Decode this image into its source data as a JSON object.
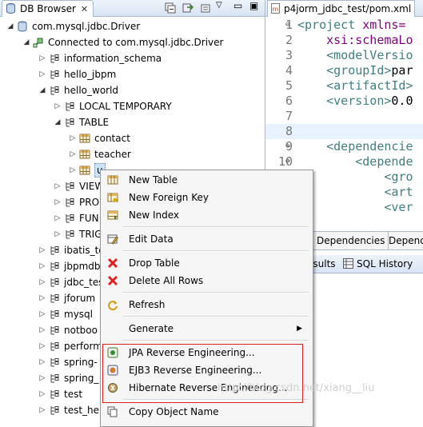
{
  "db_browser": {
    "title": "DB Browser",
    "tree": [
      {
        "label": "com.mysql.jdbc.Driver",
        "level": 0,
        "toggle": "expanded",
        "icon": "db-driver-icon"
      },
      {
        "label": "Connected to com.mysql.jdbc.Driver",
        "level": 1,
        "toggle": "expanded",
        "icon": "connection-icon"
      },
      {
        "label": "information_schema",
        "level": 2,
        "toggle": "collapsed",
        "icon": "schema-icon"
      },
      {
        "label": "hello_jbpm",
        "level": 2,
        "toggle": "collapsed",
        "icon": "schema-icon"
      },
      {
        "label": "hello_world",
        "level": 2,
        "toggle": "expanded",
        "icon": "schema-icon"
      },
      {
        "label": "LOCAL TEMPORARY",
        "level": 3,
        "toggle": "collapsed",
        "icon": "schema-icon"
      },
      {
        "label": "TABLE",
        "level": 3,
        "toggle": "expanded",
        "icon": "schema-icon"
      },
      {
        "label": "contact",
        "level": 4,
        "toggle": "collapsed",
        "icon": "table-icon"
      },
      {
        "label": "teacher",
        "level": 4,
        "toggle": "collapsed",
        "icon": "table-icon"
      },
      {
        "label": "u",
        "level": 4,
        "toggle": "collapsed",
        "icon": "table-icon",
        "selected": true
      },
      {
        "label": "VIEW",
        "level": 3,
        "toggle": "collapsed",
        "icon": "schema-icon"
      },
      {
        "label": "PRO",
        "level": 3,
        "toggle": "collapsed",
        "icon": "schema-icon"
      },
      {
        "label": "FUN",
        "level": 3,
        "toggle": "collapsed",
        "icon": "schema-icon"
      },
      {
        "label": "TRIG",
        "level": 3,
        "toggle": "collapsed",
        "icon": "schema-icon"
      },
      {
        "label": "ibatis_te",
        "level": 2,
        "toggle": "collapsed",
        "icon": "schema-icon"
      },
      {
        "label": "jbpmdb",
        "level": 2,
        "toggle": "collapsed",
        "icon": "schema-icon"
      },
      {
        "label": "jdbc_tes",
        "level": 2,
        "toggle": "collapsed",
        "icon": "schema-icon"
      },
      {
        "label": "jforum",
        "level": 2,
        "toggle": "collapsed",
        "icon": "schema-icon"
      },
      {
        "label": "mysql",
        "level": 2,
        "toggle": "collapsed",
        "icon": "schema-icon"
      },
      {
        "label": "notboo",
        "level": 2,
        "toggle": "collapsed",
        "icon": "schema-icon"
      },
      {
        "label": "perform",
        "level": 2,
        "toggle": "collapsed",
        "icon": "schema-icon"
      },
      {
        "label": "spring-",
        "level": 2,
        "toggle": "collapsed",
        "icon": "schema-icon"
      },
      {
        "label": "spring_",
        "level": 2,
        "toggle": "collapsed",
        "icon": "schema-icon"
      },
      {
        "label": "test",
        "level": 2,
        "toggle": "collapsed",
        "icon": "schema-icon"
      },
      {
        "label": "test_hel",
        "level": 2,
        "toggle": "collapsed",
        "icon": "schema-icon"
      }
    ]
  },
  "editor": {
    "tab_title": "p4jorm_jdbc_test/pom.xml",
    "lines": [
      {
        "n": "1",
        "fold": "⊖",
        "segments": [
          {
            "c": "tag",
            "t": "<project "
          },
          {
            "c": "attr",
            "t": "xmlns="
          }
        ]
      },
      {
        "n": "2",
        "fold": "",
        "segments": [
          {
            "c": "attr",
            "t": "    xsi:schemaLo"
          }
        ]
      },
      {
        "n": "3",
        "fold": "",
        "segments": [
          {
            "c": "tag",
            "t": "    <modelVersio"
          }
        ]
      },
      {
        "n": "4",
        "fold": "",
        "segments": [
          {
            "c": "tag",
            "t": "    <groupId>"
          },
          {
            "c": "txt",
            "t": "par"
          }
        ]
      },
      {
        "n": "5",
        "fold": "",
        "segments": [
          {
            "c": "tag",
            "t": "    <artifactId>"
          }
        ]
      },
      {
        "n": "6",
        "fold": "",
        "segments": [
          {
            "c": "tag",
            "t": "    <version>"
          },
          {
            "c": "txt",
            "t": "0.0"
          }
        ]
      },
      {
        "n": "7",
        "fold": "",
        "segments": []
      },
      {
        "n": "8",
        "fold": "",
        "segments": [],
        "highlight": true
      },
      {
        "n": "9",
        "fold": "⊖",
        "segments": [
          {
            "c": "tag",
            "t": "    <dependencie"
          }
        ]
      },
      {
        "n": "10",
        "fold": "⊖",
        "segments": [
          {
            "c": "tag",
            "t": "        <depende"
          }
        ]
      },
      {
        "n": "",
        "fold": "",
        "segments": [
          {
            "c": "tag",
            "t": "            <gro"
          }
        ]
      },
      {
        "n": "",
        "fold": "",
        "segments": [
          {
            "c": "tag",
            "t": "            <art"
          }
        ]
      },
      {
        "n": "",
        "fold": "",
        "segments": [
          {
            "c": "tag",
            "t": "            <ver"
          }
        ]
      }
    ],
    "pom_tabs": [
      "Dependencies",
      "Depend"
    ],
    "bottom_tabs": [
      "esults",
      "SQL History"
    ]
  },
  "context_menu": {
    "items": [
      {
        "label": "New Table",
        "icon": "new-table-icon",
        "submenu": false
      },
      {
        "label": "New Foreign Key",
        "icon": "new-foreign-key-icon",
        "submenu": false
      },
      {
        "label": "New Index",
        "icon": "new-index-icon",
        "submenu": false
      },
      {
        "sep": true
      },
      {
        "label": "Edit Data",
        "icon": "edit-data-icon",
        "submenu": false
      },
      {
        "sep": true
      },
      {
        "label": "Drop Table",
        "icon": "drop-table-icon",
        "submenu": false
      },
      {
        "label": "Delete All Rows",
        "icon": "delete-rows-icon",
        "submenu": false
      },
      {
        "sep": true
      },
      {
        "label": "Refresh",
        "icon": "refresh-icon",
        "submenu": false
      },
      {
        "sep": true
      },
      {
        "label": "Generate",
        "icon": "",
        "submenu": true
      },
      {
        "sep": true
      },
      {
        "label": "JPA Reverse Engineering...",
        "icon": "jpa-icon",
        "submenu": false
      },
      {
        "label": "EJB3 Reverse Engineering...",
        "icon": "ejb3-icon",
        "submenu": false
      },
      {
        "label": "Hibernate Reverse Engineering...",
        "icon": "hibernate-icon",
        "submenu": false
      },
      {
        "sep": true
      },
      {
        "label": "Copy Object Name",
        "icon": "copy-icon",
        "submenu": false
      }
    ]
  },
  "watermark": "http://blog.csdn.net/xiang__liu",
  "colors": {
    "highlight_box": "#dd2222",
    "tag": "#3f7f7f",
    "attr": "#7f007f"
  }
}
